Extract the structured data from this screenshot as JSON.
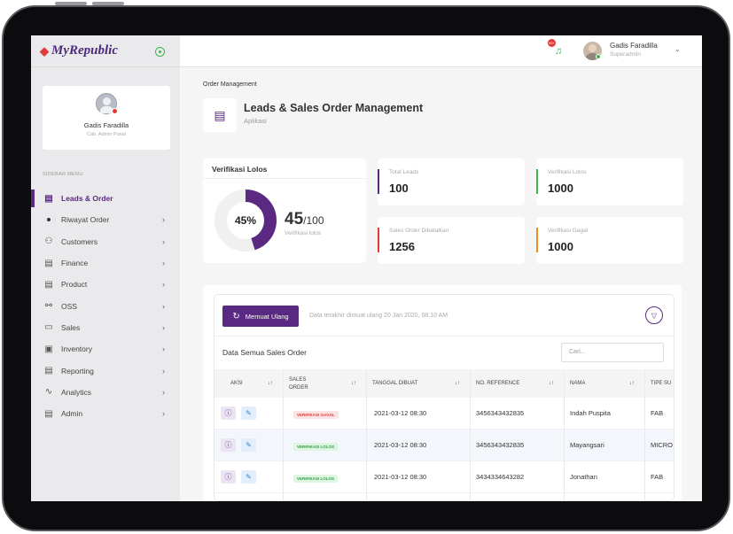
{
  "app": {
    "logo": "MyRepublic"
  },
  "profile": {
    "name": "Gadis Faradilla",
    "role": "Cab. Admin Pusat"
  },
  "sidebar": {
    "title": "SIDEBAR MENU",
    "items": [
      {
        "label": "Leads & Order",
        "icon": "document-icon"
      },
      {
        "label": "Riwayat Order",
        "icon": "dot-icon"
      },
      {
        "label": "Customers",
        "icon": "users-icon"
      },
      {
        "label": "Finance",
        "icon": "document-icon"
      },
      {
        "label": "Product",
        "icon": "document-icon"
      },
      {
        "label": "OSS",
        "icon": "network-icon"
      },
      {
        "label": "Sales",
        "icon": "money-icon"
      },
      {
        "label": "Inventory",
        "icon": "box-icon"
      },
      {
        "label": "Reporting",
        "icon": "document-icon"
      },
      {
        "label": "Analytics",
        "icon": "pulse-icon"
      },
      {
        "label": "Admin",
        "icon": "document-icon"
      }
    ]
  },
  "topbar": {
    "user_name": "Gadis Faradilla",
    "user_role": "Superadmin",
    "notif_badge": "99+"
  },
  "page": {
    "breadcrumb": "Order Management",
    "title": "Leads & Sales Order Management",
    "subtitle": "Aplikasi"
  },
  "verif": {
    "title": "Verifikasi Lolos",
    "percent_label": "45%",
    "value": "45",
    "total": "/100",
    "sub": "Verifikasi lolos",
    "percent": 45
  },
  "stats": [
    {
      "label": "Total Leads",
      "value": "100",
      "color": "#5a2a82"
    },
    {
      "label": "Verifikasi Lolos",
      "value": "1000",
      "color": "#3bb54a"
    },
    {
      "label": "Sales Order Dibatalkan",
      "value": "1256",
      "color": "#e53935"
    },
    {
      "label": "Verifikasi Gagal",
      "value": "1000",
      "color": "#f08a24"
    }
  ],
  "table": {
    "reload_label": "Memuat Ulang",
    "last_update": "Data terakhir dimuat ulang 20 Jan 2020, 08:10 AM",
    "title": "Data Semua Sales Order",
    "search_placeholder": "Cari...",
    "headers": {
      "aksi": "AKSI",
      "sales1": "SALES",
      "sales2": "ORDER",
      "tanggal": "TANGGAL DIBUAT",
      "ref": "NO. REFERENCE",
      "nama": "NAMA",
      "tipe": "TIPE SU"
    },
    "rows": [
      {
        "status": "VERIFIKASI GAGAL",
        "tanggal": "2021-03-12 08:30",
        "ref": "3456343432835",
        "nama": "Indah Puspita",
        "tipe": "FAB"
      },
      {
        "status": "VERIFIKASI LOLOS",
        "tanggal": "2021-03-12 08:30",
        "ref": "3456343432835",
        "nama": "Mayangsari",
        "tipe": "MICRO"
      },
      {
        "status": "VERIFIKASI LOLOS",
        "tanggal": "2021-03-12 08:30",
        "ref": "3434334643282",
        "nama": "Jonathan",
        "tipe": "FAB"
      }
    ]
  },
  "colors": {
    "brand": "#5a2a82",
    "green": "#3bb54a",
    "red": "#e53935",
    "orange": "#f08a24"
  }
}
